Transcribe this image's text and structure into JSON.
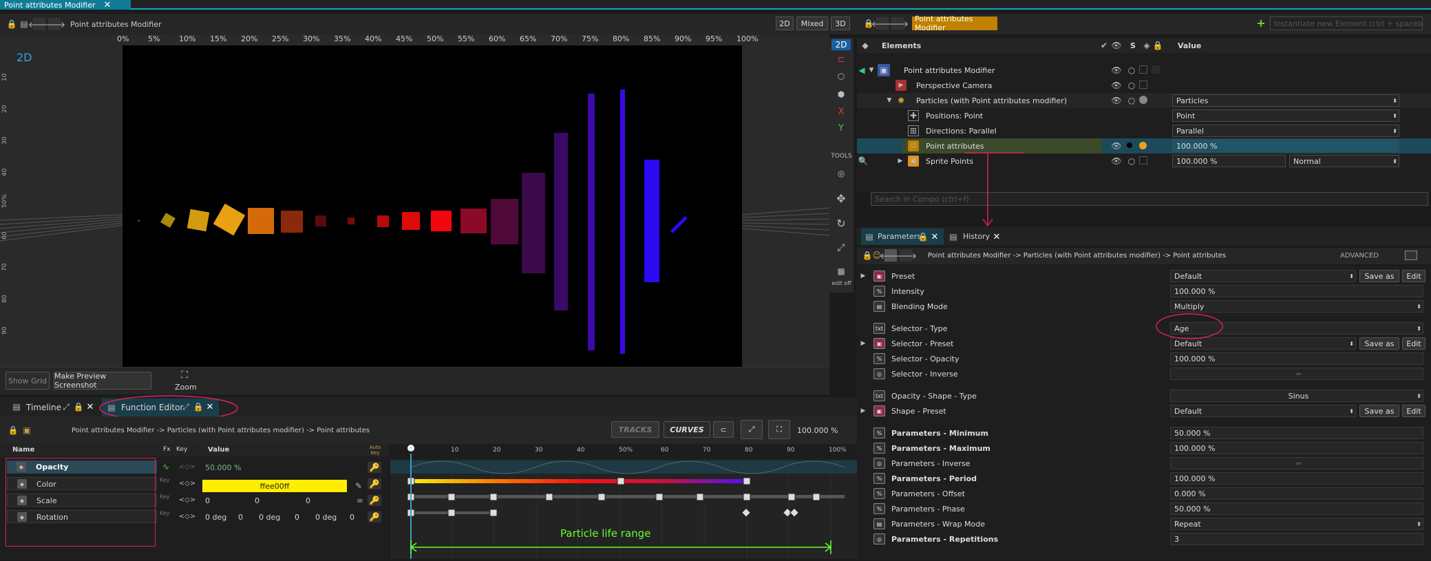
{
  "main_tab": {
    "label": "Point attributes Modifier"
  },
  "viewport": {
    "title": "Point attributes Modifier",
    "mode_buttons": [
      "2D",
      "Mixed",
      "3D"
    ],
    "canvas_label": "2D",
    "ruler_top": [
      "0%",
      "5%",
      "10%",
      "15%",
      "20%",
      "25%",
      "30%",
      "35%",
      "40%",
      "45%",
      "50%",
      "55%",
      "60%",
      "65%",
      "70%",
      "75%",
      "80%",
      "85%",
      "90%",
      "95%",
      "100%"
    ],
    "ruler_left": [
      "10",
      "20",
      "30",
      "40",
      "50%",
      "60",
      "70",
      "80",
      "90"
    ],
    "side_tools": {
      "mode_2d": "2D",
      "x": "X",
      "y": "Y",
      "tools": "TOOLS",
      "edit_off": "edit off"
    },
    "show_grid": "Show Grid",
    "make_preview": "Make Preview Screenshot",
    "zoom": "Zoom"
  },
  "bottom_tabs": {
    "timeline": "Timeline",
    "function_editor": "Function Editor"
  },
  "function_editor": {
    "breadcrumb": "Point attributes Modifier -> Particles (with Point attributes modifier) -> Point attributes",
    "tracks": "TRACKS",
    "curves": "CURVES",
    "zoom": "100.000 %",
    "columns": {
      "name": "Name",
      "fx": "Fx",
      "key": "Key",
      "value": "Value",
      "auto_key": "Auto Key"
    },
    "rows": [
      {
        "name": "Opacity",
        "value": "50.000 %"
      },
      {
        "name": "Color",
        "value": "ffee00ff"
      },
      {
        "name": "Scale",
        "values": [
          "0",
          "0",
          "0"
        ]
      },
      {
        "name": "Rotation",
        "values": [
          "0 deg",
          "0",
          "0 deg",
          "0",
          "0 deg",
          "0"
        ]
      }
    ],
    "key_label": "Key",
    "timeline_ticks": [
      "0",
      "10",
      "20",
      "30",
      "40",
      "50%",
      "60",
      "70",
      "80",
      "90",
      "100%"
    ],
    "annotation": "Particle life range",
    "accent_color": "#ffee00"
  },
  "right_header": {
    "title": "Point attributes Modifier",
    "search_placeholder": "Instantiate new Element (ctrl + spacebar)"
  },
  "elements": {
    "header": {
      "elements": "Elements",
      "s": "S",
      "value": "Value"
    },
    "rows": [
      {
        "name": "Point attributes Modifier",
        "value": ""
      },
      {
        "name": "Perspective Camera",
        "value": ""
      },
      {
        "name": "Particles (with Point attributes modifier)",
        "value": "Particles"
      },
      {
        "name": "Positions: Point",
        "value": "Point"
      },
      {
        "name": "Directions: Parallel",
        "value": "Parallel"
      },
      {
        "name": "Point attributes",
        "value": "100.000 %"
      },
      {
        "name": "Sprite Points",
        "value": "100.000 %",
        "extra": "Normal"
      }
    ],
    "search_placeholder": "Search in Compo (ctrl+f)"
  },
  "param_tabs": {
    "parameters": "Parameters",
    "history": "History"
  },
  "params_header": {
    "breadcrumb": "Point attributes Modifier -> Particles (with Point attributes modifier) -> Point attributes",
    "advanced": "ADVANCED"
  },
  "parameters": [
    {
      "label": "Preset",
      "value": "Default",
      "save": "Save as",
      "edit": "Edit"
    },
    {
      "label": "Intensity",
      "value": "100.000 %"
    },
    {
      "label": "Blending Mode",
      "value": "Multiply"
    },
    {
      "label": "Selector - Type",
      "value": "Age"
    },
    {
      "label": "Selector - Preset",
      "value": "Default",
      "save": "Save as",
      "edit": "Edit"
    },
    {
      "label": "Selector - Opacity",
      "value": "100.000 %"
    },
    {
      "label": "Selector - Inverse",
      "value": ""
    },
    {
      "label": "Opacity - Shape - Type",
      "value": "Sinus"
    },
    {
      "label": "Shape - Preset",
      "value": "Default",
      "save": "Save as",
      "edit": "Edit"
    },
    {
      "label": "Parameters - Minimum",
      "value": "50.000 %"
    },
    {
      "label": "Parameters - Maximum",
      "value": "100.000 %"
    },
    {
      "label": "Parameters - Inverse",
      "value": ""
    },
    {
      "label": "Parameters - Period",
      "value": "100.000 %"
    },
    {
      "label": "Parameters - Offset",
      "value": "0.000 %"
    },
    {
      "label": "Parameters - Phase",
      "value": "50.000 %"
    },
    {
      "label": "Parameters - Wrap Mode",
      "value": "Repeat"
    },
    {
      "label": "Parameters - Repetitions",
      "value": "3"
    }
  ],
  "colors": {
    "accent": "#1aa5c5",
    "highlight": "#e3b000",
    "annotation_red": "#d6245c",
    "annotation_green": "#66ff33"
  }
}
